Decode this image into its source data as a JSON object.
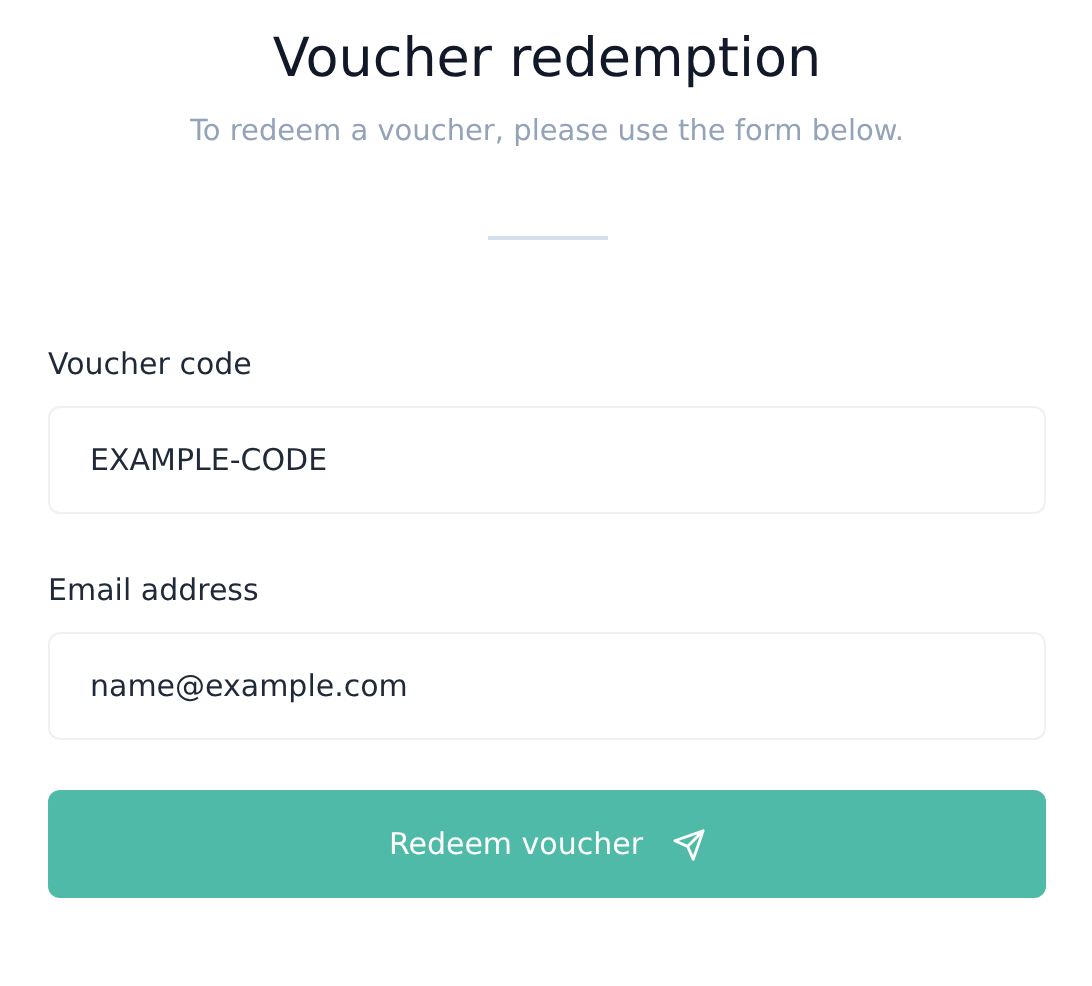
{
  "title": "Voucher redemption",
  "subtitle": "To redeem a voucher, please use the form below.",
  "fields": [
    {
      "label": "Voucher code",
      "value": "EXAMPLE-CODE"
    },
    {
      "label": "Email address",
      "value": "name@example.com"
    }
  ],
  "submit_button": {
    "label": "Redeem voucher"
  }
}
